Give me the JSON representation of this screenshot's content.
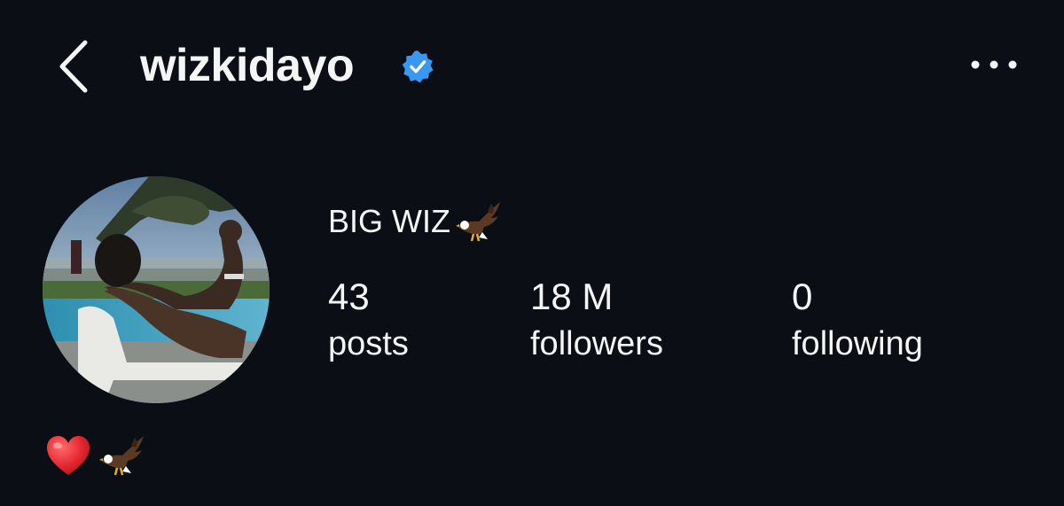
{
  "header": {
    "username": "wizkidayo",
    "verified": true,
    "back_icon": "chevron-left-icon",
    "verified_icon": "verified-badge-icon",
    "more_icon": "more-horizontal-icon"
  },
  "profile": {
    "display_name": "BIG WIZ",
    "display_name_emoji": "eagle-icon",
    "avatar": "profile-photo"
  },
  "stats": {
    "posts": {
      "value": "43",
      "label": "posts"
    },
    "followers": {
      "value": "18 M",
      "label": "followers"
    },
    "following": {
      "value": "0",
      "label": "following"
    }
  },
  "bio": {
    "emojis": [
      "red-heart-icon",
      "eagle-icon"
    ]
  },
  "colors": {
    "background": "#0b0e14",
    "text": "#f5f5f5",
    "verified_blue": "#3897f0"
  }
}
